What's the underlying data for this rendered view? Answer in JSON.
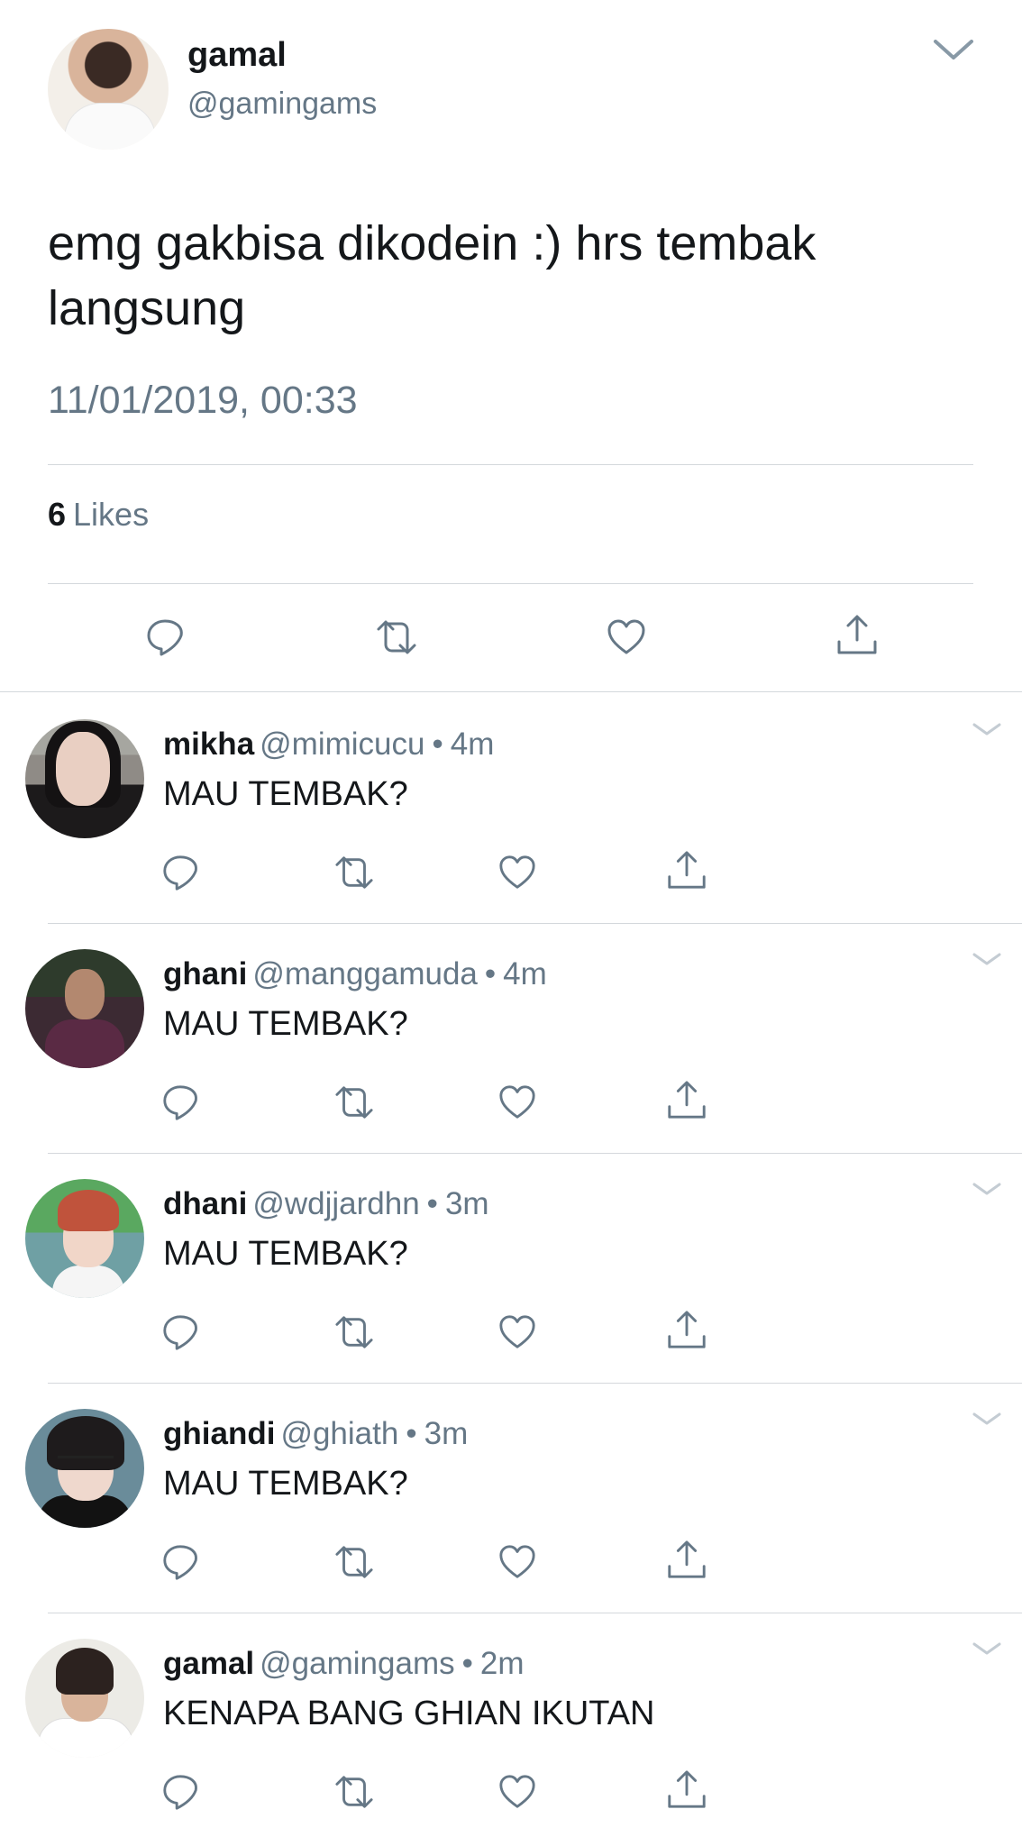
{
  "tweet": {
    "name": "gamal",
    "handle": "@gamingams",
    "text": "emg gakbisa dikodein :) hrs tembak langsung",
    "timestamp": "11/01/2019, 00:33",
    "likes_count": "6",
    "likes_label": "Likes",
    "actions": [
      "reply-icon",
      "retweet-icon",
      "like-icon",
      "share-icon"
    ]
  },
  "replies": [
    {
      "name": "mikha",
      "handle": "@mimicucu",
      "separator": "•",
      "time": "4m",
      "text": "MAU TEMBAK?"
    },
    {
      "name": "ghani",
      "handle": "@manggamuda",
      "separator": "•",
      "time": "4m",
      "text": "MAU TEMBAK?"
    },
    {
      "name": "dhani",
      "handle": "@wdjjardhn",
      "separator": "•",
      "time": "3m",
      "text": "MAU TEMBAK?"
    },
    {
      "name": "ghiandi",
      "handle": "@ghiath",
      "separator": "•",
      "time": "3m",
      "text": "MAU TEMBAK?"
    },
    {
      "name": "gamal",
      "handle": "@gamingams",
      "separator": "•",
      "time": "2m",
      "text": "KENAPA BANG GHIAN IKUTAN"
    }
  ],
  "colors": {
    "text": "#14171a",
    "secondary": "#657786",
    "divider": "#d4d8dc",
    "icon": "#657786"
  }
}
